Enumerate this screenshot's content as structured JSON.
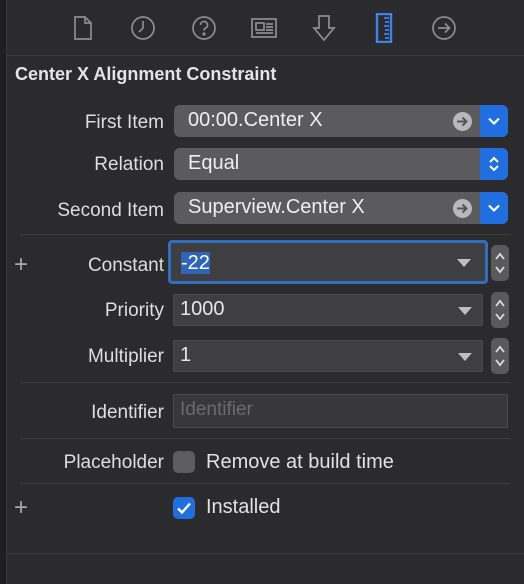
{
  "toolbar": {
    "icons": [
      "file-icon",
      "history-icon",
      "help-icon",
      "identity-icon",
      "attributes-icon",
      "size-ruler-icon",
      "connections-icon"
    ],
    "active": "size-ruler-icon",
    "accent": "#3d83f0"
  },
  "panel": {
    "title": "Center X Alignment Constraint"
  },
  "first_item": {
    "label": "First Item",
    "value": "00:00.Center X"
  },
  "relation": {
    "label": "Relation",
    "value": "Equal"
  },
  "second_item": {
    "label": "Second Item",
    "value": "Superview.Center X"
  },
  "constant": {
    "label": "Constant",
    "value": "-22"
  },
  "priority": {
    "label": "Priority",
    "value": "1000"
  },
  "multiplier": {
    "label": "Multiplier",
    "value": "1"
  },
  "identifier": {
    "label": "Identifier",
    "placeholder": "Identifier"
  },
  "placeholder": {
    "label": "Placeholder",
    "checkbox_label": "Remove at build time",
    "checked": false
  },
  "installed": {
    "checkbox_label": "Installed",
    "checked": true
  },
  "colors": {
    "background": "#2b2b2d",
    "popup": "#5b5b5e",
    "accent_blue": "#1f6fe0",
    "focus_ring": "#2f6fbf"
  }
}
